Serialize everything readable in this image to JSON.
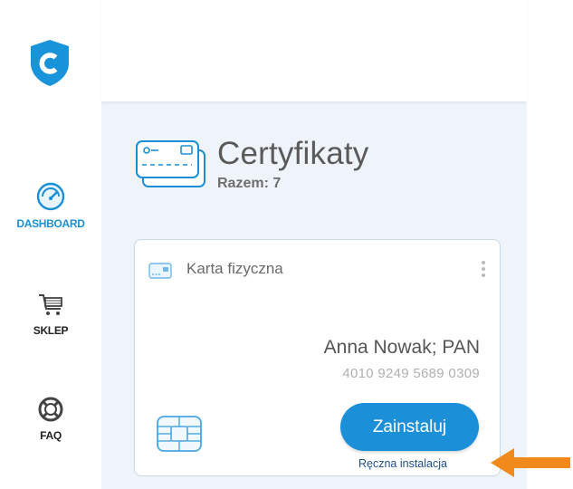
{
  "sidebar": {
    "items": [
      {
        "label": "DASHBOARD",
        "icon": "speedometer-icon",
        "active": true
      },
      {
        "label": "SKLEP",
        "icon": "shopping-cart-icon",
        "active": false
      },
      {
        "label": "FAQ",
        "icon": "lifebuoy-icon",
        "active": false
      }
    ]
  },
  "header": {
    "title": "Certyfikaty",
    "total": "Razem: 7"
  },
  "card": {
    "type": "Karta fizyczna",
    "owner": "Anna Nowak; PAN",
    "number": "4010 9249 5689 0309",
    "install_label": "Zainstaluj",
    "manual_label": "Ręczna instalacja"
  },
  "colors": {
    "accent": "#1b8fd8",
    "logo": "#1993d9",
    "background": "#eef4f9",
    "arrow": "#f08a1c",
    "link": "#1f4f8a"
  }
}
